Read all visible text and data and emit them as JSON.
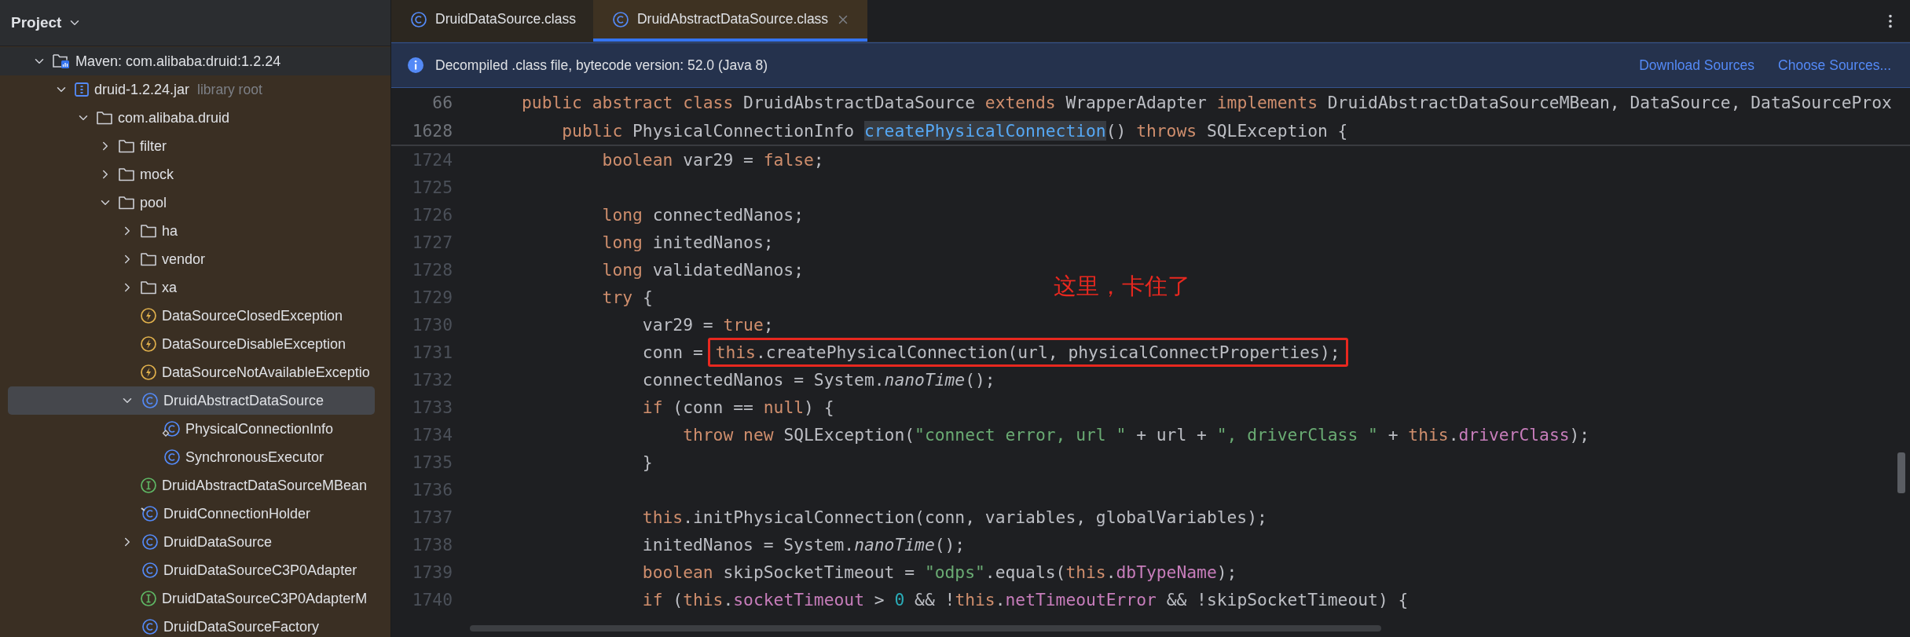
{
  "sidebar": {
    "title": "Project",
    "tree": [
      {
        "label": "Maven: com.alibaba:druid:1.2.24",
        "kind": "maven",
        "expanded": true,
        "selected": false,
        "children": [
          {
            "label": "druid-1.2.24.jar",
            "note": "library root",
            "kind": "jar",
            "expanded": true,
            "selected": false,
            "children": [
              {
                "label": "com.alibaba.druid",
                "kind": "folder",
                "expanded": true,
                "selected": false,
                "children": [
                  {
                    "label": "filter",
                    "kind": "folder",
                    "expanded": false,
                    "selected": false
                  },
                  {
                    "label": "mock",
                    "kind": "folder",
                    "expanded": false,
                    "selected": false
                  },
                  {
                    "label": "pool",
                    "kind": "folder",
                    "expanded": true,
                    "selected": false,
                    "children": [
                      {
                        "label": "ha",
                        "kind": "folder",
                        "expanded": false,
                        "selected": false
                      },
                      {
                        "label": "vendor",
                        "kind": "folder",
                        "expanded": false,
                        "selected": false
                      },
                      {
                        "label": "xa",
                        "kind": "folder",
                        "expanded": false,
                        "selected": false
                      },
                      {
                        "label": "DataSourceClosedException",
                        "kind": "exception",
                        "selected": false
                      },
                      {
                        "label": "DataSourceDisableException",
                        "kind": "exception",
                        "selected": false
                      },
                      {
                        "label": "DataSourceNotAvailableExceptio",
                        "kind": "exception",
                        "selected": false
                      },
                      {
                        "label": "DruidAbstractDataSource",
                        "kind": "class",
                        "expanded": true,
                        "selected": true,
                        "children": [
                          {
                            "label": "PhysicalConnectionInfo",
                            "kind": "nested-class",
                            "selected": false
                          },
                          {
                            "label": "SynchronousExecutor",
                            "kind": "class",
                            "selected": false
                          }
                        ]
                      },
                      {
                        "label": "DruidAbstractDataSourceMBean",
                        "kind": "interface",
                        "selected": false
                      },
                      {
                        "label": "DruidConnectionHolder",
                        "kind": "pinned-class",
                        "selected": false
                      },
                      {
                        "label": "DruidDataSource",
                        "kind": "class",
                        "expanded": false,
                        "selected": false
                      },
                      {
                        "label": "DruidDataSourceC3P0Adapter",
                        "kind": "class",
                        "selected": false
                      },
                      {
                        "label": "DruidDataSourceC3P0AdapterM",
                        "kind": "interface",
                        "selected": false
                      },
                      {
                        "label": "DruidDataSourceFactory",
                        "kind": "class",
                        "selected": false
                      }
                    ]
                  }
                ]
              }
            ]
          }
        ]
      }
    ]
  },
  "editor": {
    "tabs": [
      {
        "label": "DruidDataSource.class",
        "selected": false
      },
      {
        "label": "DruidAbstractDataSource.class",
        "selected": true
      }
    ],
    "banner": {
      "message": "Decompiled .class file, bytecode version: 52.0 (Java 8)",
      "actions": [
        "Download Sources",
        "Choose Sources..."
      ]
    },
    "sticky_lines": [
      {
        "number": "66",
        "tokens": [
          {
            "kind": "kw",
            "text": "public abstract class "
          },
          {
            "kind": "plain",
            "text": "DruidAbstractDataSource "
          },
          {
            "kind": "kw",
            "text": "extends "
          },
          {
            "kind": "plain",
            "text": "WrapperAdapter "
          },
          {
            "kind": "kw",
            "text": "implements "
          },
          {
            "kind": "plain",
            "text": "DruidAbstractDataSourceMBean, DataSource, DataSourceProx"
          }
        ]
      },
      {
        "number": "1628",
        "tokens": [
          {
            "kind": "kw",
            "text": "    public "
          },
          {
            "kind": "plain",
            "text": "PhysicalConnectionInfo "
          },
          {
            "kind": "decl",
            "text": "createPhysicalConnection"
          },
          {
            "kind": "plain",
            "text": "() "
          },
          {
            "kind": "kw",
            "text": "throws "
          },
          {
            "kind": "plain",
            "text": "SQLException {"
          }
        ]
      }
    ],
    "lines": [
      {
        "number": "1724",
        "tokens": [
          {
            "kind": "kw",
            "text": "        boolean "
          },
          {
            "kind": "plain",
            "text": "var29 = "
          },
          {
            "kind": "kw",
            "text": "false"
          },
          {
            "kind": "plain",
            "text": ";"
          }
        ]
      },
      {
        "number": "1725"
      },
      {
        "number": "1726",
        "tokens": [
          {
            "kind": "kw",
            "text": "        long "
          },
          {
            "kind": "plain",
            "text": "connectedNanos;"
          }
        ]
      },
      {
        "number": "1727",
        "tokens": [
          {
            "kind": "kw",
            "text": "        long "
          },
          {
            "kind": "plain",
            "text": "initedNanos;"
          }
        ]
      },
      {
        "number": "1728",
        "tokens": [
          {
            "kind": "kw",
            "text": "        long "
          },
          {
            "kind": "plain",
            "text": "validatedNanos;"
          }
        ]
      },
      {
        "number": "1729",
        "tokens": [
          {
            "kind": "kw",
            "text": "        try "
          },
          {
            "kind": "plain",
            "text": "{"
          }
        ],
        "note": "这里，卡住了"
      },
      {
        "number": "1730",
        "tokens": [
          {
            "kind": "plain",
            "text": "            var29 = "
          },
          {
            "kind": "kw",
            "text": "true"
          },
          {
            "kind": "plain",
            "text": ";"
          }
        ]
      },
      {
        "number": "1731",
        "tokens": [
          {
            "kind": "plain",
            "text": "            conn = "
          },
          {
            "kind": "kw",
            "text": "this",
            "boxed": true
          },
          {
            "kind": "plain",
            "text": ".createPhysicalConnection(url, physicalConnectProperties);",
            "boxed": true
          }
        ]
      },
      {
        "number": "1732",
        "tokens": [
          {
            "kind": "plain",
            "text": "            connectedNanos = System."
          },
          {
            "kind": "italic",
            "text": "nanoTime"
          },
          {
            "kind": "plain",
            "text": "();"
          }
        ]
      },
      {
        "number": "1733",
        "tokens": [
          {
            "kind": "kw",
            "text": "            if "
          },
          {
            "kind": "plain",
            "text": "(conn == "
          },
          {
            "kind": "kw",
            "text": "null"
          },
          {
            "kind": "plain",
            "text": ") {"
          }
        ]
      },
      {
        "number": "1734",
        "tokens": [
          {
            "kind": "kw",
            "text": "                throw new "
          },
          {
            "kind": "plain",
            "text": "SQLException("
          },
          {
            "kind": "str",
            "text": "\"connect error, url \""
          },
          {
            "kind": "plain",
            "text": " + url + "
          },
          {
            "kind": "str",
            "text": "\", driverClass \""
          },
          {
            "kind": "plain",
            "text": " + "
          },
          {
            "kind": "kw",
            "text": "this"
          },
          {
            "kind": "plain",
            "text": "."
          },
          {
            "kind": "field",
            "text": "driverClass"
          },
          {
            "kind": "plain",
            "text": ");"
          }
        ]
      },
      {
        "number": "1735",
        "tokens": [
          {
            "kind": "plain",
            "text": "            }"
          }
        ]
      },
      {
        "number": "1736"
      },
      {
        "number": "1737",
        "tokens": [
          {
            "kind": "kw",
            "text": "            this"
          },
          {
            "kind": "plain",
            "text": ".initPhysicalConnection(conn, variables, globalVariables);"
          }
        ]
      },
      {
        "number": "1738",
        "tokens": [
          {
            "kind": "plain",
            "text": "            initedNanos = System."
          },
          {
            "kind": "italic",
            "text": "nanoTime"
          },
          {
            "kind": "plain",
            "text": "();"
          }
        ]
      },
      {
        "number": "1739",
        "tokens": [
          {
            "kind": "kw",
            "text": "            boolean "
          },
          {
            "kind": "plain",
            "text": "skipSocketTimeout = "
          },
          {
            "kind": "str",
            "text": "\"odps\""
          },
          {
            "kind": "plain",
            "text": ".equals("
          },
          {
            "kind": "kw",
            "text": "this"
          },
          {
            "kind": "plain",
            "text": "."
          },
          {
            "kind": "field",
            "text": "dbTypeName"
          },
          {
            "kind": "plain",
            "text": ");"
          }
        ]
      },
      {
        "number": "1740",
        "tokens": [
          {
            "kind": "kw",
            "text": "            if "
          },
          {
            "kind": "plain",
            "text": "("
          },
          {
            "kind": "kw",
            "text": "this"
          },
          {
            "kind": "plain",
            "text": "."
          },
          {
            "kind": "field",
            "text": "socketTimeout"
          },
          {
            "kind": "plain",
            "text": " > "
          },
          {
            "kind": "num",
            "text": "0"
          },
          {
            "kind": "plain",
            "text": " && !"
          },
          {
            "kind": "kw",
            "text": "this"
          },
          {
            "kind": "plain",
            "text": "."
          },
          {
            "kind": "field",
            "text": "netTimeoutError"
          },
          {
            "kind": "plain",
            "text": " && !skipSocketTimeout) {"
          }
        ]
      }
    ]
  }
}
